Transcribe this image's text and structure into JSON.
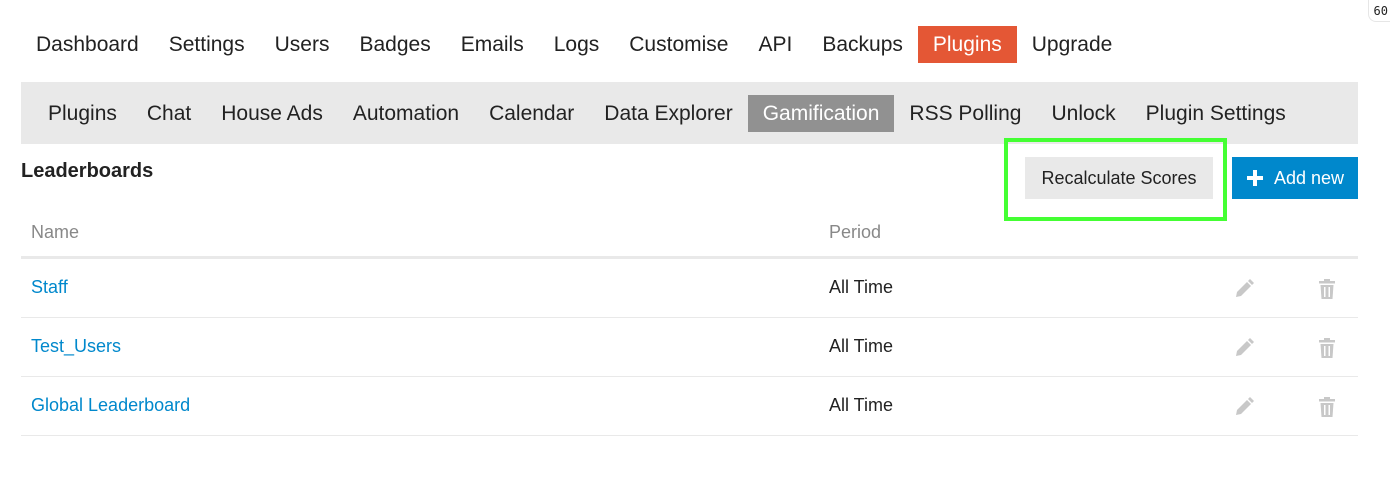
{
  "corner_badge": "60",
  "top_nav": {
    "items": [
      {
        "label": "Dashboard"
      },
      {
        "label": "Settings"
      },
      {
        "label": "Users"
      },
      {
        "label": "Badges"
      },
      {
        "label": "Emails"
      },
      {
        "label": "Logs"
      },
      {
        "label": "Customise"
      },
      {
        "label": "API"
      },
      {
        "label": "Backups"
      },
      {
        "label": "Plugins",
        "active": true
      },
      {
        "label": "Upgrade"
      }
    ]
  },
  "sub_nav": {
    "items": [
      {
        "label": "Plugins"
      },
      {
        "label": "Chat"
      },
      {
        "label": "House Ads"
      },
      {
        "label": "Automation"
      },
      {
        "label": "Calendar"
      },
      {
        "label": "Data Explorer"
      },
      {
        "label": "Gamification",
        "active": true
      },
      {
        "label": "RSS Polling"
      },
      {
        "label": "Unlock"
      },
      {
        "label": "Plugin Settings"
      }
    ]
  },
  "section": {
    "title": "Leaderboards",
    "recalculate_label": "Recalculate Scores",
    "add_label": "Add new"
  },
  "table": {
    "headers": {
      "name": "Name",
      "period": "Period"
    },
    "rows": [
      {
        "name": "Staff",
        "period": "All Time"
      },
      {
        "name": "Test_Users",
        "period": "All Time"
      },
      {
        "name": "Global Leaderboard",
        "period": "All Time"
      }
    ]
  },
  "colors": {
    "active_tab": "#e45735",
    "active_subtab": "#919191",
    "primary_button": "#0088cc",
    "link": "#0088cc",
    "highlight": "#44ff33"
  },
  "icons": {
    "plus": "plus-icon",
    "edit": "pencil-icon",
    "delete": "trash-icon"
  }
}
